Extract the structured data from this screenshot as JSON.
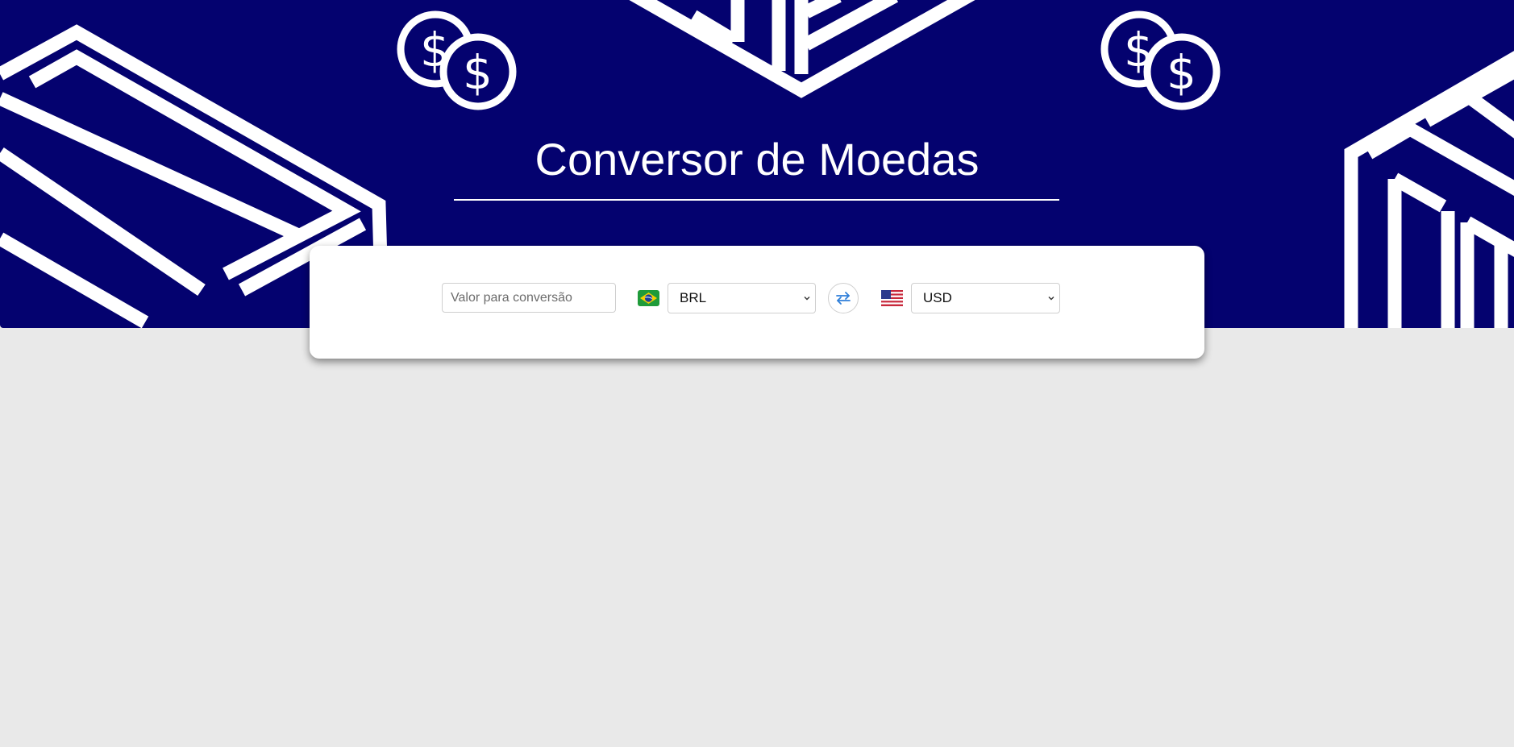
{
  "header": {
    "title": "Conversor de Moedas"
  },
  "converter": {
    "amount_placeholder": "Valor para conversão",
    "amount_value": "",
    "from_currency": {
      "selected": "BRL",
      "flag_icon": "brazil-flag-icon"
    },
    "to_currency": {
      "selected": "USD",
      "flag_icon": "usa-flag-icon"
    },
    "swap_icon": "swap-arrows-icon"
  },
  "colors": {
    "hero_background": "#04026f",
    "page_background": "#e9e9e9",
    "card_background": "#ffffff",
    "swap_icon_color": "#2f7fd9",
    "decoration": "#ffffff"
  }
}
